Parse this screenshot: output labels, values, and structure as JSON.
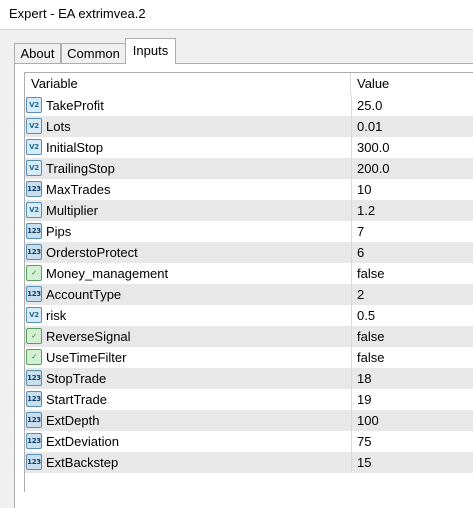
{
  "window": {
    "title": "Expert - EA extrimvea.2"
  },
  "tabs": [
    {
      "label": "About",
      "active": false
    },
    {
      "label": "Common",
      "active": false
    },
    {
      "label": "Inputs",
      "active": true
    }
  ],
  "table": {
    "headers": {
      "variable": "Variable",
      "value": "Value"
    },
    "icon_glyphs": {
      "double": "V2",
      "integer": "123",
      "bool": "✓"
    },
    "rows": [
      {
        "name": "TakeProfit",
        "value": "25.0",
        "icon": "double-type-icon"
      },
      {
        "name": "Lots",
        "value": "0.01",
        "icon": "double-type-icon"
      },
      {
        "name": "InitialStop",
        "value": "300.0",
        "icon": "double-type-icon"
      },
      {
        "name": "TrailingStop",
        "value": "200.0",
        "icon": "double-type-icon"
      },
      {
        "name": "MaxTrades",
        "value": "10",
        "icon": "integer-type-icon"
      },
      {
        "name": "Multiplier",
        "value": "1.2",
        "icon": "double-type-icon"
      },
      {
        "name": "Pips",
        "value": "7",
        "icon": "integer-type-icon"
      },
      {
        "name": "OrderstoProtect",
        "value": "6",
        "icon": "integer-type-icon"
      },
      {
        "name": "Money_management",
        "value": "false",
        "icon": "bool-type-icon"
      },
      {
        "name": "AccountType",
        "value": "2",
        "icon": "integer-type-icon"
      },
      {
        "name": "risk",
        "value": "0.5",
        "icon": "double-type-icon"
      },
      {
        "name": "ReverseSignal",
        "value": "false",
        "icon": "bool-type-icon"
      },
      {
        "name": "UseTimeFilter",
        "value": "false",
        "icon": "bool-type-icon"
      },
      {
        "name": "StopTrade",
        "value": "18",
        "icon": "integer-type-icon"
      },
      {
        "name": "StartTrade",
        "value": "19",
        "icon": "integer-type-icon"
      },
      {
        "name": "ExtDepth",
        "value": "100",
        "icon": "integer-type-icon"
      },
      {
        "name": "ExtDeviation",
        "value": "75",
        "icon": "integer-type-icon"
      },
      {
        "name": "ExtBackstep",
        "value": "15",
        "icon": "integer-type-icon"
      }
    ]
  }
}
